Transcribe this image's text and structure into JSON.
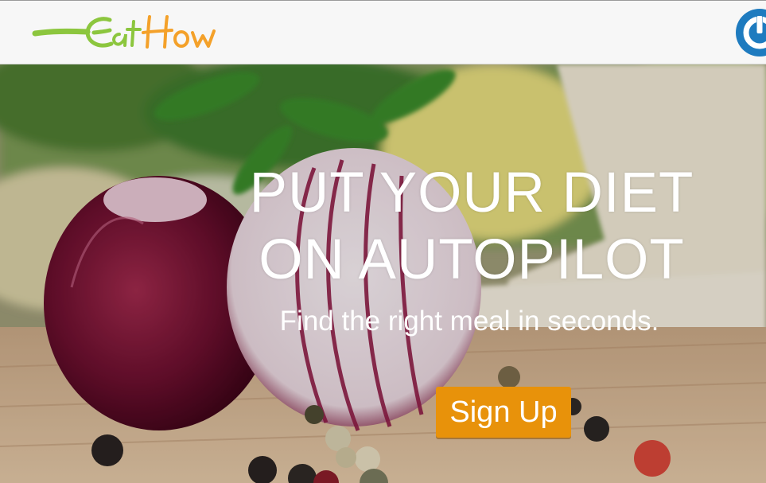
{
  "header": {
    "logo_text": "EatHow",
    "logo_colors": {
      "eat": "#8cc63e",
      "how": "#f4a12a"
    },
    "power_icon": "power-icon",
    "power_color": "#1e7bbf"
  },
  "hero": {
    "headline_line1": "PUT YOUR DIET",
    "headline_line2": "ON AUTOPILOT",
    "subheadline": "Find the right meal in seconds.",
    "cta_label": "Sign Up",
    "cta_color": "#e8920a",
    "background_image": "red onion with peppercorns on cutting board"
  }
}
